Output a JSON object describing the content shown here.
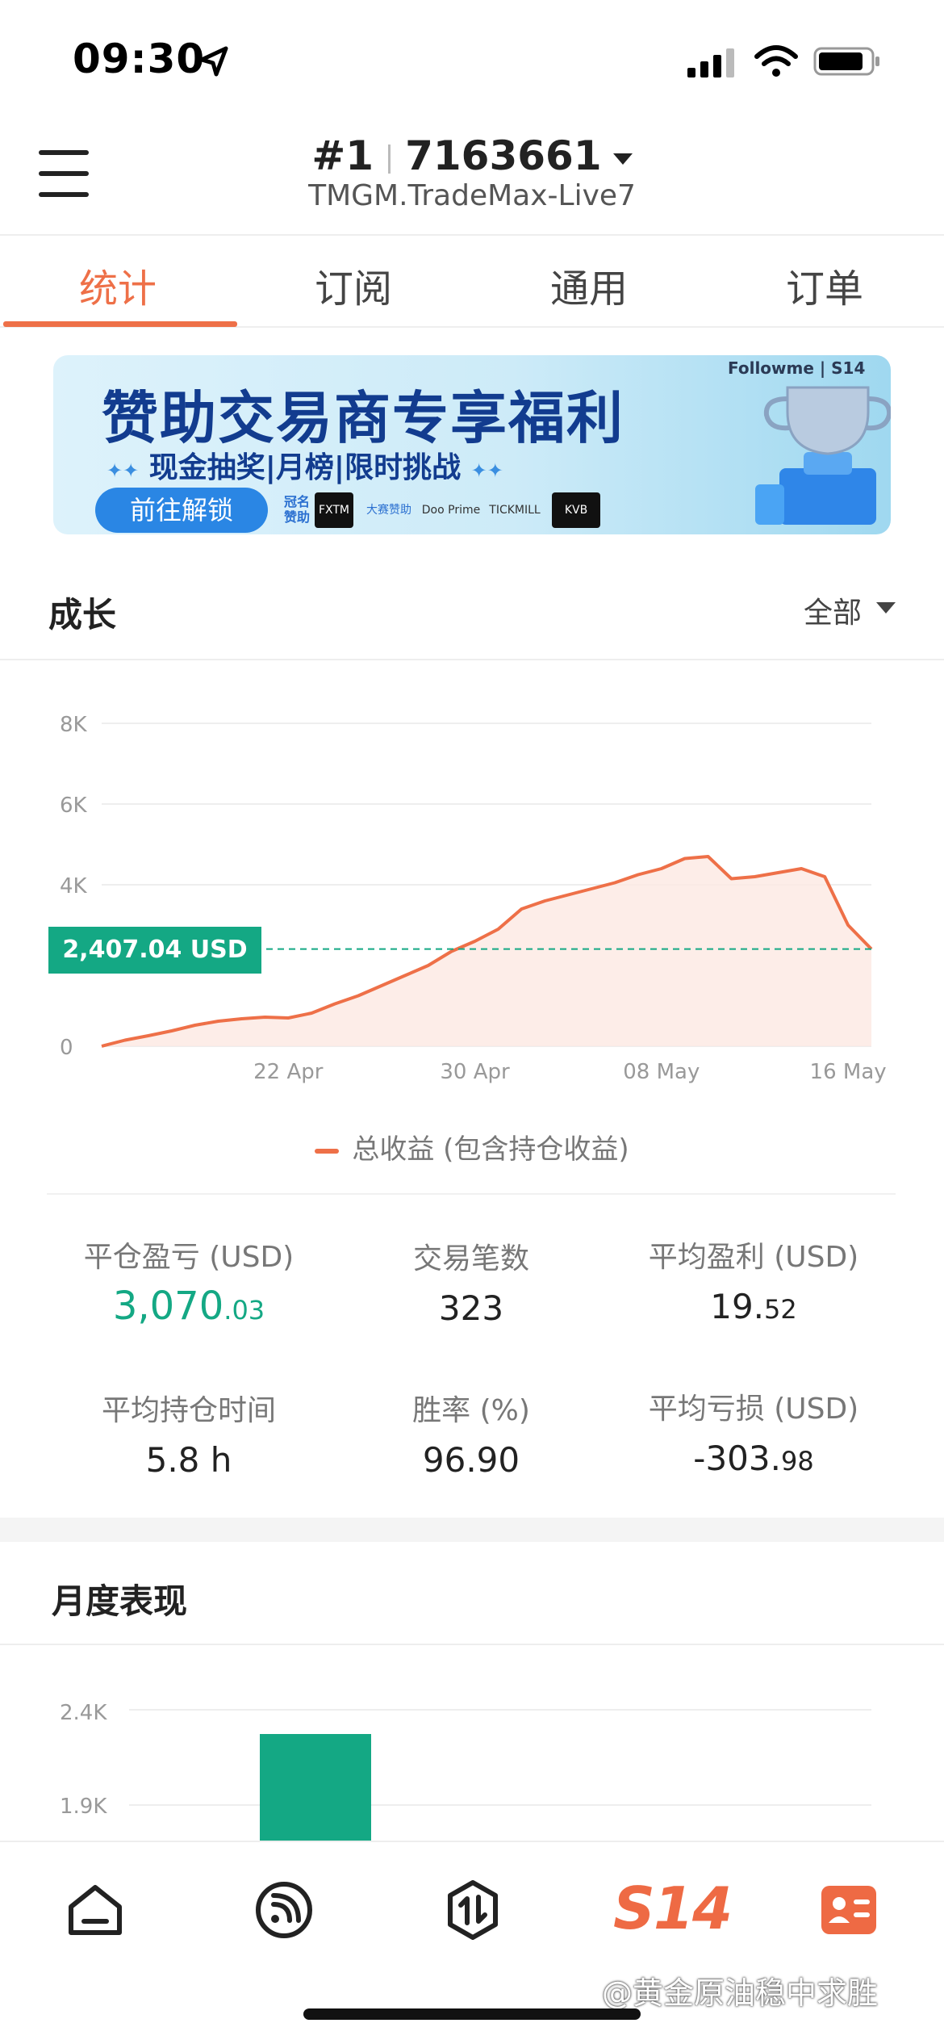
{
  "status_bar": {
    "time": "09:30"
  },
  "header": {
    "rank": "#1",
    "account_id": "7163661",
    "server": "TMGM.TradeMax-Live7"
  },
  "tabs": [
    {
      "label": "统计",
      "active": true
    },
    {
      "label": "订阅",
      "active": false
    },
    {
      "label": "通用",
      "active": false
    },
    {
      "label": "订单",
      "active": false
    }
  ],
  "banner": {
    "title": "赞助交易商专享福利",
    "subtitle": "现金抽奖|月榜|限时挑战",
    "subtitle_dots": "✦✦",
    "button": "前往解锁",
    "brand": "Followme | S14",
    "sponsor_label_1": "冠名",
    "sponsor_label_2": "赞助",
    "sponsors": [
      "FXTM",
      "大赛赞助",
      "Doo Prime",
      "TICKMILL",
      "KVB"
    ]
  },
  "growth": {
    "title": "成长",
    "filter": "全部",
    "current_value_badge": "2,407.04 USD",
    "legend": "总收益 (包含持仓收益)"
  },
  "chart_data": {
    "type": "area",
    "title": "",
    "xlabel": "",
    "ylabel": "",
    "y_ticks": [
      "0",
      "4K",
      "6K",
      "8K"
    ],
    "ylim": [
      0,
      8000
    ],
    "x_ticks": [
      "22 Apr",
      "30 Apr",
      "08 May",
      "16 May"
    ],
    "series": [
      {
        "name": "总收益 (包含持仓收益)",
        "x": [
          "14 Apr",
          "15 Apr",
          "16 Apr",
          "17 Apr",
          "18 Apr",
          "19 Apr",
          "20 Apr",
          "21 Apr",
          "22 Apr",
          "23 Apr",
          "24 Apr",
          "25 Apr",
          "26 Apr",
          "27 Apr",
          "28 Apr",
          "29 Apr",
          "30 Apr",
          "01 May",
          "02 May",
          "03 May",
          "04 May",
          "05 May",
          "06 May",
          "07 May",
          "08 May",
          "09 May",
          "10 May",
          "11 May",
          "12 May",
          "13 May",
          "14 May",
          "15 May",
          "16 May",
          "17 May"
        ],
        "values": [
          0,
          150,
          260,
          380,
          520,
          620,
          680,
          720,
          700,
          820,
          1050,
          1250,
          1500,
          1750,
          2000,
          2350,
          2600,
          2900,
          3400,
          3600,
          3750,
          3900,
          4050,
          4250,
          4400,
          4650,
          4700,
          4150,
          4200,
          4300,
          4400,
          4200,
          3000,
          2407
        ]
      }
    ],
    "reference_value": 2407.04,
    "colors": {
      "line": "#ee7048",
      "fill": "#fde9e2",
      "reference": "#14a884"
    }
  },
  "stats": [
    {
      "label": "平仓盈亏 (USD)",
      "value_main": "3,070",
      "value_decimal": ".03",
      "highlight": true
    },
    {
      "label": "交易笔数",
      "value_main": "323",
      "value_decimal": ""
    },
    {
      "label": "平均盈利 (USD)",
      "value_main": "19.",
      "value_decimal": "52"
    },
    {
      "label": "平均持仓时间",
      "value_main": "5.8 h",
      "value_decimal": ""
    },
    {
      "label": "胜率 (%)",
      "value_main": "96.90",
      "value_decimal": ""
    },
    {
      "label": "平均亏损 (USD)",
      "value_main": "-303.",
      "value_decimal": "98"
    }
  ],
  "monthly": {
    "title": "月度表现",
    "y_ticks": [
      "2.4K",
      "1.9K"
    ],
    "bar_color": "#14a884"
  },
  "bottom_nav": {
    "items": [
      "home-icon",
      "feed-icon",
      "trade-icon",
      "s14-icon",
      "profile-card-icon"
    ],
    "s14_label": "S14"
  },
  "watermark": "@黄金原油稳中求胜",
  "accent_color": "#ee7048"
}
